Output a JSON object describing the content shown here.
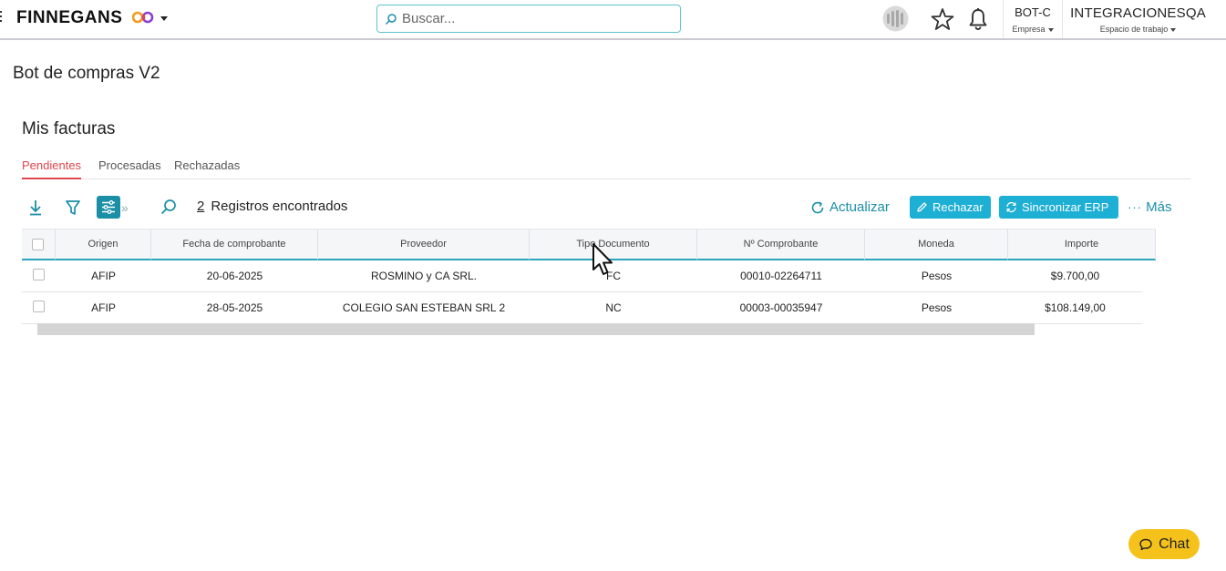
{
  "topbar": {
    "brand": "FINNEGANS",
    "search_placeholder": "Buscar...",
    "company_code": "BOT-C",
    "company_label": "Empresa",
    "workspace_name": "INTEGRACIONESQA",
    "workspace_label": "Espacio de trabajo"
  },
  "page": {
    "title": "Bot de compras V2",
    "section_title": "Mis facturas"
  },
  "tabs": [
    {
      "label": "Pendientes",
      "active": true
    },
    {
      "label": "Procesadas",
      "active": false
    },
    {
      "label": "Rechazadas",
      "active": false
    }
  ],
  "toolbar": {
    "record_count": "2",
    "records_label": "Registros encontrados",
    "refresh_label": "Actualizar",
    "reject_label": "Rechazar",
    "sync_label": "Sincronizar ERP",
    "more_label": "Más"
  },
  "grid": {
    "columns": [
      "Origen",
      "Fecha de comprobante",
      "Proveedor",
      "Tipo Documento",
      "Nº Comprobante",
      "Moneda",
      "Importe"
    ],
    "rows": [
      [
        "AFIP",
        "20-06-2025",
        "ROSMINO y CA SRL.",
        "FC",
        "00010-02264711",
        "Pesos",
        "$9.700,00"
      ],
      [
        "AFIP",
        "28-05-2025",
        "COLEGIO SAN ESTEBAN SRL 2",
        "NC",
        "00003-00035947",
        "Pesos",
        "$108.149,00"
      ]
    ]
  },
  "chat": {
    "label": "Chat"
  },
  "colors": {
    "accent": "#1eafd4",
    "active_tab": "#e0454b",
    "chat": "#f5c21c"
  }
}
